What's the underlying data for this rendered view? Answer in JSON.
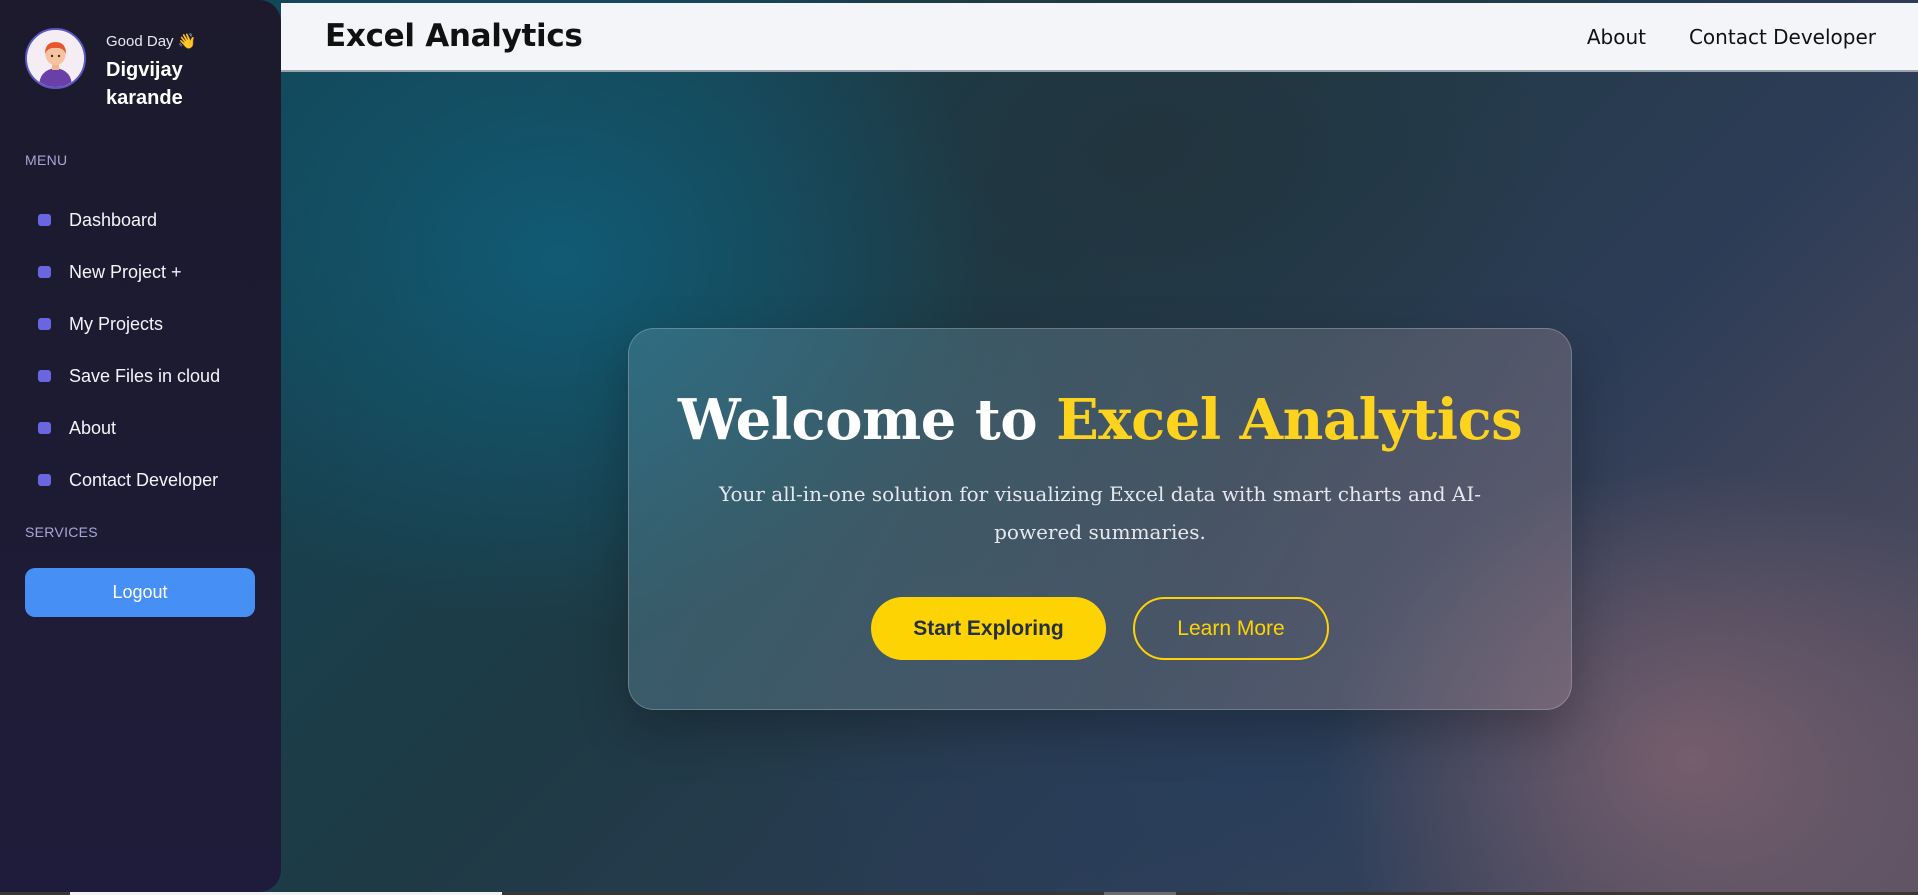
{
  "sidebar": {
    "greeting": "Good Day 👋",
    "user_name": "Digvijay karande",
    "menu_label": "MENU",
    "items": [
      {
        "label": "Dashboard"
      },
      {
        "label": "New Project +"
      },
      {
        "label": "My Projects"
      },
      {
        "label": "Save Files in cloud"
      },
      {
        "label": "About"
      },
      {
        "label": "Contact Developer"
      }
    ],
    "services_label": "SERVICES",
    "logout_label": "Logout"
  },
  "header": {
    "brand": "Excel Analytics",
    "nav": [
      {
        "label": "About"
      },
      {
        "label": "Contact Developer"
      }
    ]
  },
  "hero": {
    "title_prefix": "Welcome to ",
    "title_accent": "Excel Analytics",
    "subtitle": "Your all-in-one solution for visualizing Excel data with smart charts and AI-powered summaries.",
    "primary_button": "Start Exploring",
    "secondary_button": "Learn More"
  },
  "colors": {
    "accent_yellow": "#fdd304",
    "logout_blue": "#4690f5",
    "sidebar_bg": "#1e1c3a",
    "menu_dot": "#6a66e0"
  }
}
